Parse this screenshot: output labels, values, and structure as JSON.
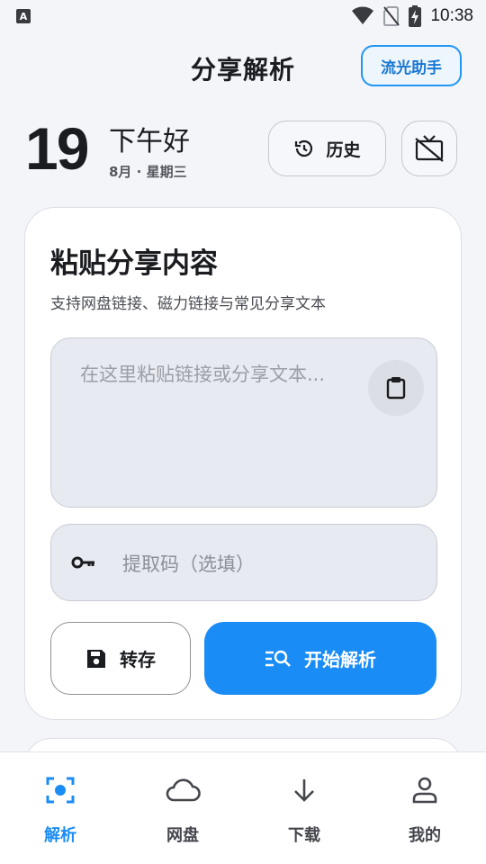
{
  "status_bar": {
    "left_icon": "A",
    "time": "10:38",
    "icons": [
      "wifi-icon",
      "no-sim-icon",
      "battery-charging-icon"
    ]
  },
  "header": {
    "title": "分享解析",
    "assistant_label": "流光助手"
  },
  "date_block": {
    "day": "19",
    "greeting": "下午好",
    "subline": "8月 · 星期三",
    "history_label": "历史"
  },
  "share_card": {
    "title": "粘贴分享内容",
    "subtitle": "支持网盘链接、磁力链接与常见分享文本",
    "input_placeholder": "在这里粘贴链接或分享文本...",
    "code_placeholder": "提取码（选填）",
    "save_label": "转存",
    "parse_label": "开始解析"
  },
  "bottom_nav": {
    "items": [
      {
        "label": "解析",
        "icon": "scan-icon",
        "active": true
      },
      {
        "label": "网盘",
        "icon": "cloud-icon",
        "active": false
      },
      {
        "label": "下载",
        "icon": "download-icon",
        "active": false
      },
      {
        "label": "我的",
        "icon": "person-icon",
        "active": false
      }
    ]
  },
  "colors": {
    "accent": "#1a8cf5",
    "background": "#f4f5f9",
    "input_bg": "#e8eaf1"
  }
}
